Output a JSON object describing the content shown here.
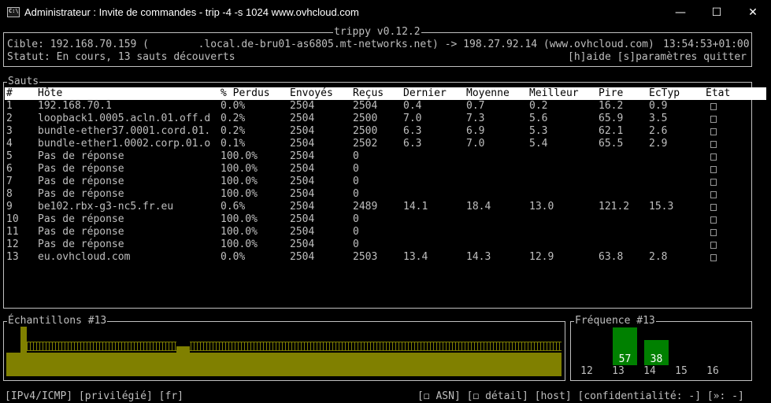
{
  "window": {
    "title": "Administrateur : Invite de commandes - trip  -4 -s 1024 www.ovhcloud.com",
    "icon_text": "C:\\",
    "minimize": "—",
    "maximize": "☐",
    "close": "✕"
  },
  "header": {
    "app": "trippy v0.12.2",
    "target": "Cible: 192.168.70.159 (        .local.de-bru01-as6805.mt-networks.net) -> 198.27.92.14 (www.ovhcloud.com)",
    "time": "13:54:53+01:00",
    "status": "Statut: En cours, 13 sauts découverts",
    "help": "[h]aide [s]paramètres quitter"
  },
  "hops_panel": {
    "title": "Sauts",
    "columns": [
      "#",
      "Hôte",
      "% Perdus",
      "Envoyés",
      "Reçus",
      "Dernier",
      "Moyenne",
      "Meilleur",
      "Pire",
      "ÉcTyp",
      "État"
    ],
    "rows": [
      {
        "n": "1",
        "host": "192.168.70.1",
        "loss": "0.0%",
        "sent": "2504",
        "recv": "2504",
        "last": "0.4",
        "avg": "0.7",
        "best": "0.2",
        "worst": "16.2",
        "stddev": "0.9"
      },
      {
        "n": "2",
        "host": "loopback1.0005.acln.01.off.d",
        "loss": "0.2%",
        "sent": "2504",
        "recv": "2500",
        "last": "7.0",
        "avg": "7.3",
        "best": "5.6",
        "worst": "65.9",
        "stddev": "3.5"
      },
      {
        "n": "3",
        "host": "bundle-ether37.0001.cord.01.",
        "loss": "0.2%",
        "sent": "2504",
        "recv": "2500",
        "last": "6.3",
        "avg": "6.9",
        "best": "5.3",
        "worst": "62.1",
        "stddev": "2.6"
      },
      {
        "n": "4",
        "host": "bundle-ether1.0002.corp.01.o",
        "loss": "0.1%",
        "sent": "2504",
        "recv": "2502",
        "last": "6.3",
        "avg": "7.0",
        "best": "5.4",
        "worst": "65.5",
        "stddev": "2.9"
      },
      {
        "n": "5",
        "host": "Pas de réponse",
        "loss": "100.0%",
        "sent": "2504",
        "recv": "0",
        "last": "",
        "avg": "",
        "best": "",
        "worst": "",
        "stddev": ""
      },
      {
        "n": "6",
        "host": "Pas de réponse",
        "loss": "100.0%",
        "sent": "2504",
        "recv": "0",
        "last": "",
        "avg": "",
        "best": "",
        "worst": "",
        "stddev": ""
      },
      {
        "n": "7",
        "host": "Pas de réponse",
        "loss": "100.0%",
        "sent": "2504",
        "recv": "0",
        "last": "",
        "avg": "",
        "best": "",
        "worst": "",
        "stddev": ""
      },
      {
        "n": "8",
        "host": "Pas de réponse",
        "loss": "100.0%",
        "sent": "2504",
        "recv": "0",
        "last": "",
        "avg": "",
        "best": "",
        "worst": "",
        "stddev": ""
      },
      {
        "n": "9",
        "host": "be102.rbx-g3-nc5.fr.eu",
        "loss": "0.6%",
        "sent": "2504",
        "recv": "2489",
        "last": "14.1",
        "avg": "18.4",
        "best": "13.0",
        "worst": "121.2",
        "stddev": "15.3"
      },
      {
        "n": "10",
        "host": "Pas de réponse",
        "loss": "100.0%",
        "sent": "2504",
        "recv": "0",
        "last": "",
        "avg": "",
        "best": "",
        "worst": "",
        "stddev": ""
      },
      {
        "n": "11",
        "host": "Pas de réponse",
        "loss": "100.0%",
        "sent": "2504",
        "recv": "0",
        "last": "",
        "avg": "",
        "best": "",
        "worst": "",
        "stddev": ""
      },
      {
        "n": "12",
        "host": "Pas de réponse",
        "loss": "100.0%",
        "sent": "2504",
        "recv": "0",
        "last": "",
        "avg": "",
        "best": "",
        "worst": "",
        "stddev": ""
      },
      {
        "n": "13",
        "host": "eu.ovhcloud.com",
        "loss": "0.0%",
        "sent": "2504",
        "recv": "2503",
        "last": "13.4",
        "avg": "14.3",
        "best": "12.9",
        "worst": "63.8",
        "stddev": "2.8"
      }
    ]
  },
  "samples_panel": {
    "title": "Échantillons #13"
  },
  "frequency_panel": {
    "title": "Fréquence #13",
    "labels": [
      "12",
      "13",
      "14",
      "15",
      "16"
    ],
    "counts": [
      null,
      "57",
      "38",
      null,
      null
    ],
    "relative_height": [
      0,
      1.0,
      0.67,
      0,
      0
    ]
  },
  "footer": {
    "left": "[IPv4/ICMP] [privilégié] [fr]",
    "right": "[◻ ASN] [◻ détail] [host] [confidentialité: -] [»: -]"
  },
  "colors": {
    "spark": "#808000",
    "freq": "#008000",
    "text": "#bfbfbf",
    "header_bg": "#ffffff"
  }
}
